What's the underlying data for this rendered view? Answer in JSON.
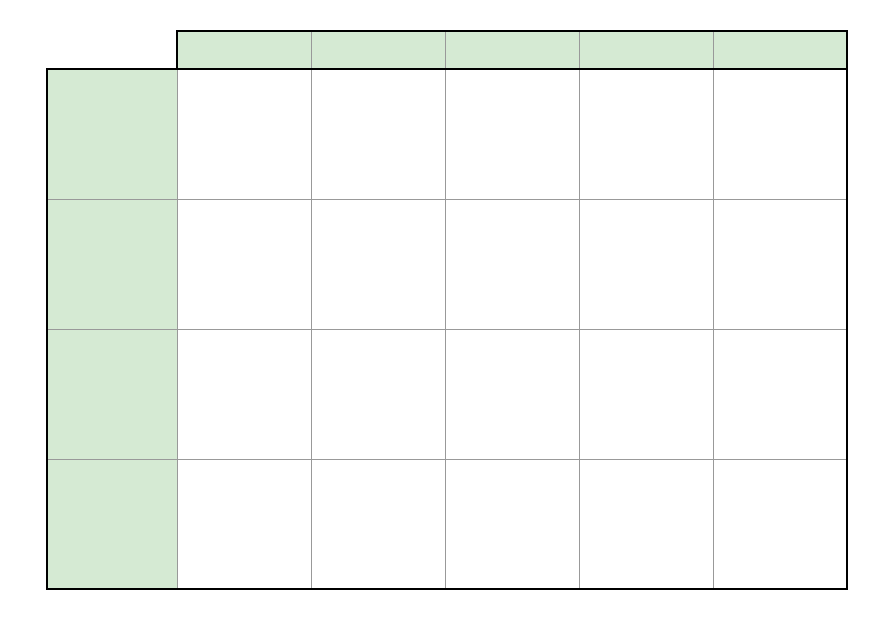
{
  "table": {
    "column_headers": [
      "",
      "",
      "",
      "",
      ""
    ],
    "row_headers": [
      "",
      "",
      "",
      ""
    ],
    "cells": [
      [
        "",
        "",
        "",
        "",
        ""
      ],
      [
        "",
        "",
        "",
        "",
        ""
      ],
      [
        "",
        "",
        "",
        "",
        ""
      ],
      [
        "",
        "",
        "",
        "",
        ""
      ]
    ],
    "colors": {
      "header_fill": "#d5ead3",
      "cell_fill": "#ffffff",
      "grid_line": "#999999",
      "outer_border": "#000000"
    }
  }
}
